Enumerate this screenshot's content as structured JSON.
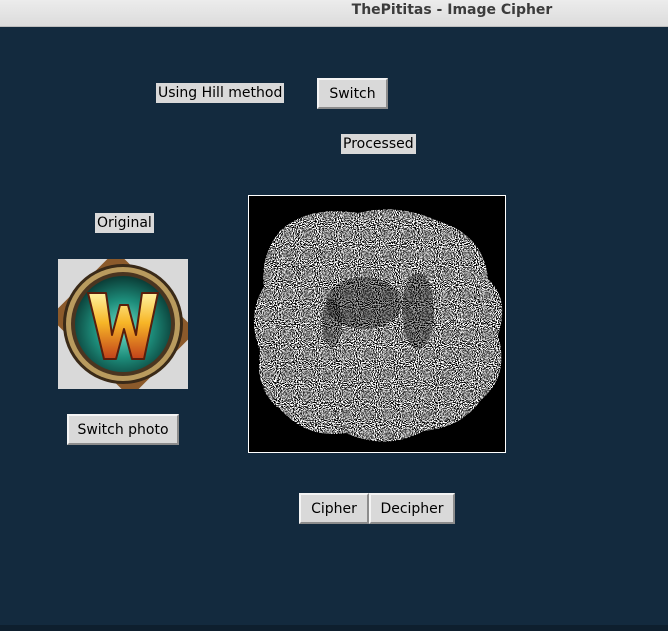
{
  "window": {
    "title": "ThePititas - Image Cipher"
  },
  "controls": {
    "method_label": "Using Hill method",
    "switch_button": "Switch",
    "processed_label": "Processed",
    "original_label": "Original",
    "switch_photo_button": "Switch photo",
    "cipher_button": "Cipher",
    "decipher_button": "Decipher"
  },
  "images": {
    "original": "world-of-warcraft-logo",
    "processed": "noise-ciphered-image"
  }
}
